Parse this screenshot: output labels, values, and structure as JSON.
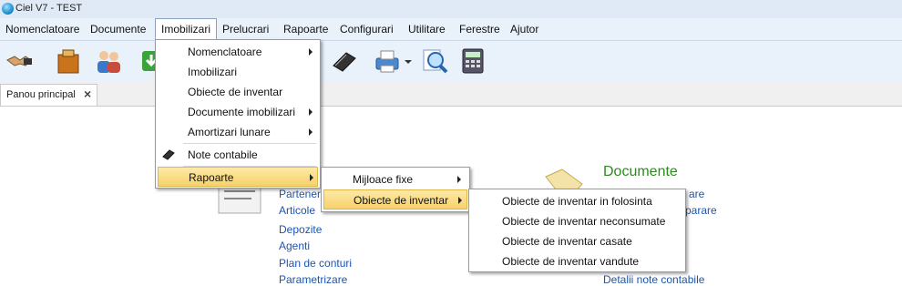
{
  "window": {
    "title": "Ciel V7 - TEST"
  },
  "menubar": [
    {
      "label": "Nomenclatoare"
    },
    {
      "label": "Documente"
    },
    {
      "label": "Imobilizari"
    },
    {
      "label": "Prelucrari"
    },
    {
      "label": "Rapoarte"
    },
    {
      "label": "Configurari"
    },
    {
      "label": "Utilitare"
    },
    {
      "label": "Ferestre"
    },
    {
      "label": "Ajutor"
    }
  ],
  "toolbar": {
    "icons": [
      "handshake-icon",
      "box-icon",
      "users-icon",
      "download-icon",
      "book-icon",
      "printer-icon",
      "zoom-icon",
      "calculator-icon"
    ]
  },
  "tabs": [
    {
      "label": "Panou principal"
    }
  ],
  "dashboard": {
    "nomenclatoare_links": [
      "Parteneri",
      "Articole",
      "Depozite",
      "Agenti",
      "Plan de conturi",
      "Parametrizare"
    ],
    "documente_title": "Documente",
    "documente_links": [
      "are",
      "parare",
      "Detalii note contabile"
    ]
  },
  "imobilizari_menu": {
    "items": [
      "Nomenclatoare",
      "Imobilizari",
      "Obiecte de inventar",
      "Documente imobilizari",
      "Amortizari lunare",
      "Note contabile",
      "Rapoarte"
    ]
  },
  "rapoarte_submenu": {
    "items": [
      "Mijloace fixe",
      "Obiecte de inventar"
    ]
  },
  "obiecte_submenu": {
    "items": [
      "Obiecte de inventar in folosinta",
      "Obiecte de inventar neconsumate",
      "Obiecte de inventar casate",
      "Obiecte de inventar vandute"
    ]
  }
}
